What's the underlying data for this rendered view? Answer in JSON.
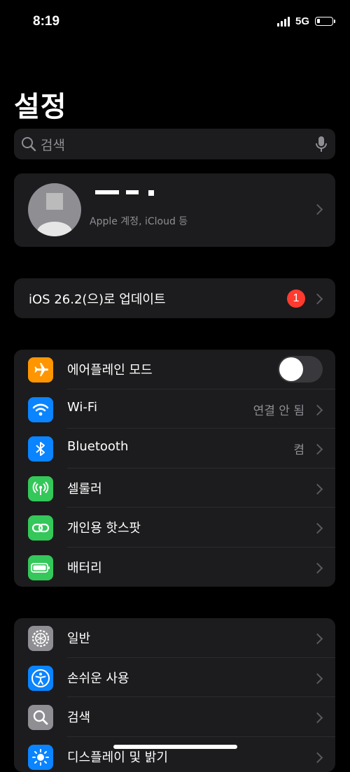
{
  "status_bar": {
    "time": "8:19",
    "network": "5G",
    "battery_level": 0.15
  },
  "page_title": "설정",
  "search": {
    "placeholder": "검색"
  },
  "profile": {
    "subtitle": "Apple 계정, iCloud 등"
  },
  "update": {
    "label": "iOS 26.2(으)로 업데이트",
    "badge": "1",
    "badge_color": "#ff3b30"
  },
  "connectivity": [
    {
      "label": "에어플레인 모드",
      "icon": "airplane-icon",
      "color": "#ff9500",
      "toggle": false
    },
    {
      "label": "Wi-Fi",
      "icon": "wifi-icon",
      "color": "#0a84ff",
      "value": "연결 안 됨"
    },
    {
      "label": "Bluetooth",
      "icon": "bluetooth-icon",
      "color": "#0a84ff",
      "value": "켬"
    },
    {
      "label": "셀룰러",
      "icon": "cellular-icon",
      "color": "#34c759"
    },
    {
      "label": "개인용 핫스팟",
      "icon": "hotspot-icon",
      "color": "#34c759"
    },
    {
      "label": "배터리",
      "icon": "battery-icon",
      "color": "#34c759"
    }
  ],
  "general": [
    {
      "label": "일반",
      "icon": "gear-icon",
      "color": "#8e8e93"
    },
    {
      "label": "손쉬운 사용",
      "icon": "accessibility-icon",
      "color": "#0a84ff"
    },
    {
      "label": "검색",
      "icon": "search-icon",
      "color": "#8e8e93"
    },
    {
      "label": "디스플레이 및 밝기",
      "icon": "brightness-icon",
      "color": "#0a84ff"
    }
  ]
}
